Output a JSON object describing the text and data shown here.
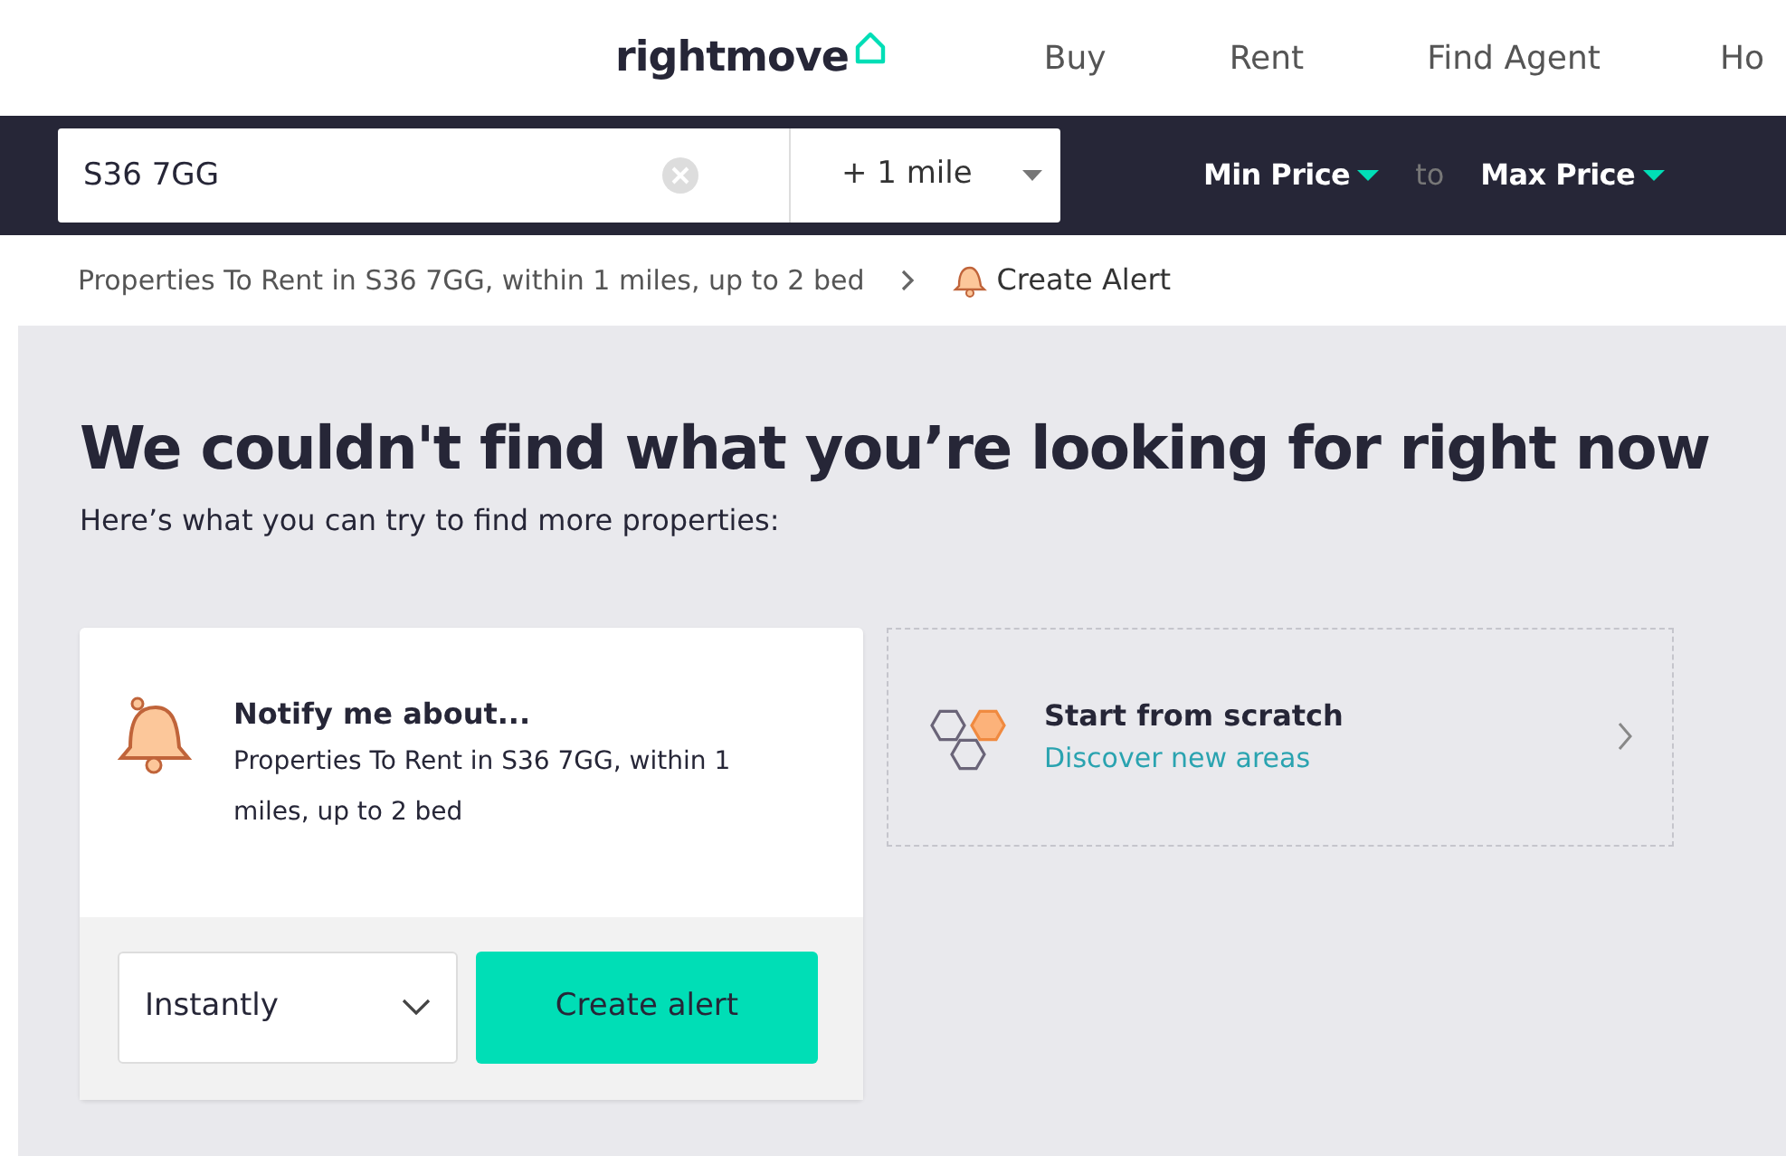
{
  "header": {
    "logo": "rightmove",
    "nav": [
      "Buy",
      "Rent",
      "Find Agent",
      "Ho"
    ]
  },
  "search_bar": {
    "location": "S36 7GG",
    "radius": "+ 1 mile",
    "min_price": "Min Price",
    "separator": "to",
    "max_price": "Max Price"
  },
  "breadcrumb": {
    "text": "Properties To Rent in S36 7GG, within 1 miles, up to 2 bed",
    "alert_link": "Create Alert"
  },
  "heading": "We couldn't find what you’re looking for right now",
  "subheading": "Here’s what you can try to find more properties:",
  "alert_card": {
    "title": "Notify me about...",
    "description": "Properties To Rent in S36 7GG, within 1 miles, up to 2 bed",
    "frequency": "Instantly",
    "button": "Create alert"
  },
  "scratch_card": {
    "title": "Start from scratch",
    "link": "Discover new areas"
  }
}
